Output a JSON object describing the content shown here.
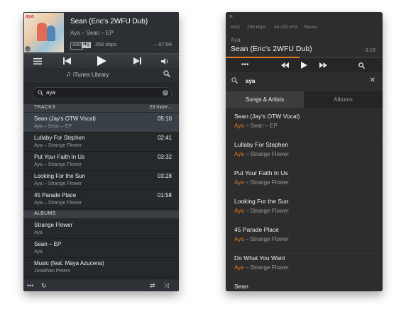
{
  "left_player": {
    "now_playing": {
      "title": "Sean (Eric's 2WFU Dub)",
      "subtitle": "Aya – Sean – EP",
      "format": "AAC",
      "quality": "HQ",
      "bitrate": "256 kbps",
      "time": "– 07:06",
      "album_art_text": "aya"
    },
    "library_label": "iTunes Library",
    "search_value": "aya",
    "tracks_header": "TRACKS",
    "tracks_more": "23 more...",
    "tracks": [
      {
        "name": "Sean (Jay's OTW Vocal)",
        "artist": "Aya – Sean – EP",
        "duration": "05:10"
      },
      {
        "name": "Lullaby For Stephen",
        "artist": "Aya – Strange Flower",
        "duration": "02:41"
      },
      {
        "name": "Put Your Faith In Us",
        "artist": "Aya – Strange Flower",
        "duration": "03:32"
      },
      {
        "name": "Looking For the Sun",
        "artist": "Aya – Strange Flower",
        "duration": "03:28"
      },
      {
        "name": "45 Parade Place",
        "artist": "Aya – Strange Flower",
        "duration": "01:58"
      }
    ],
    "albums_header": "ALBUMS",
    "albums": [
      {
        "name": "Strange Flower",
        "artist": "Aya"
      },
      {
        "name": "Sean – EP",
        "artist": "Aya"
      },
      {
        "name": "Music (feat. Maya Azucena)",
        "artist": "Jonathan Peters"
      }
    ]
  },
  "right_player": {
    "meta": [
      "AAC",
      "256 kbps",
      "44.100 kHz",
      "Stereo"
    ],
    "artist": "Aya",
    "title": "Sean (Eric's 2WFU Dub)",
    "time": "3:18",
    "progress_fraction": 0.47,
    "search_value": "aya",
    "tabs": [
      "Songs & Artists",
      "Albums"
    ],
    "results": [
      {
        "name": "Sean (Jay's OTW Vocal)",
        "artist": "Aya",
        "album": "Sean – EP"
      },
      {
        "name": "Lullaby For Stephen",
        "artist": "Aya",
        "album": "Strange Flower"
      },
      {
        "name": "Put Your Faith In Us",
        "artist": "Aya",
        "album": "Strange Flower"
      },
      {
        "name": "Looking For the Sun",
        "artist": "Aya",
        "album": "Strange Flower"
      },
      {
        "name": "45 Parade Place",
        "artist": "Aya",
        "album": "Strange Flower"
      },
      {
        "name": "Do What You Want",
        "artist": "Aya",
        "album": "Strange Flower"
      },
      {
        "name": "Sean",
        "artist": "",
        "album": ""
      }
    ],
    "separator": " – "
  },
  "colors": {
    "accent": "#e07b1f",
    "left_bg": "#26292c",
    "right_bg": "#2d2d2d"
  },
  "icons": [
    "menu-icon",
    "previous-icon",
    "play-icon",
    "next-icon",
    "volume-icon",
    "music-note-icon",
    "search-icon",
    "clear-icon",
    "more-icon",
    "refresh-icon",
    "repeat-icon",
    "shuffle-icon",
    "close-icon",
    "rewind-icon",
    "fast-forward-icon"
  ]
}
